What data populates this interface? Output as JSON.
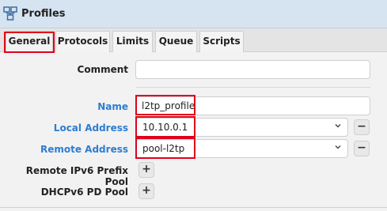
{
  "window": {
    "title": "Profiles",
    "icon": "network-profile-icon"
  },
  "tabs": [
    {
      "label": "General",
      "active": true
    },
    {
      "label": "Protocols",
      "active": false
    },
    {
      "label": "Limits",
      "active": false
    },
    {
      "label": "Queue",
      "active": false
    },
    {
      "label": "Scripts",
      "active": false
    }
  ],
  "form": {
    "comment": {
      "label": "Comment",
      "value": ""
    },
    "name": {
      "label": "Name",
      "value": "l2tp_profile"
    },
    "local_address": {
      "label": "Local Address",
      "value": "10.10.0.1"
    },
    "remote_address": {
      "label": "Remote Address",
      "value": "pool-l2tp"
    },
    "remote_ipv6_prefix_pool": {
      "label": "Remote IPv6 Prefix Pool",
      "add": "+"
    },
    "dhcpv6_pd_pool": {
      "label": "DHCPv6 PD Pool",
      "add": "+"
    },
    "remove_symbol": "−"
  },
  "colors": {
    "label_blue": "#2d7dd2",
    "highlight_red": "#e0001b",
    "titlebar": "#d6e3f0"
  }
}
